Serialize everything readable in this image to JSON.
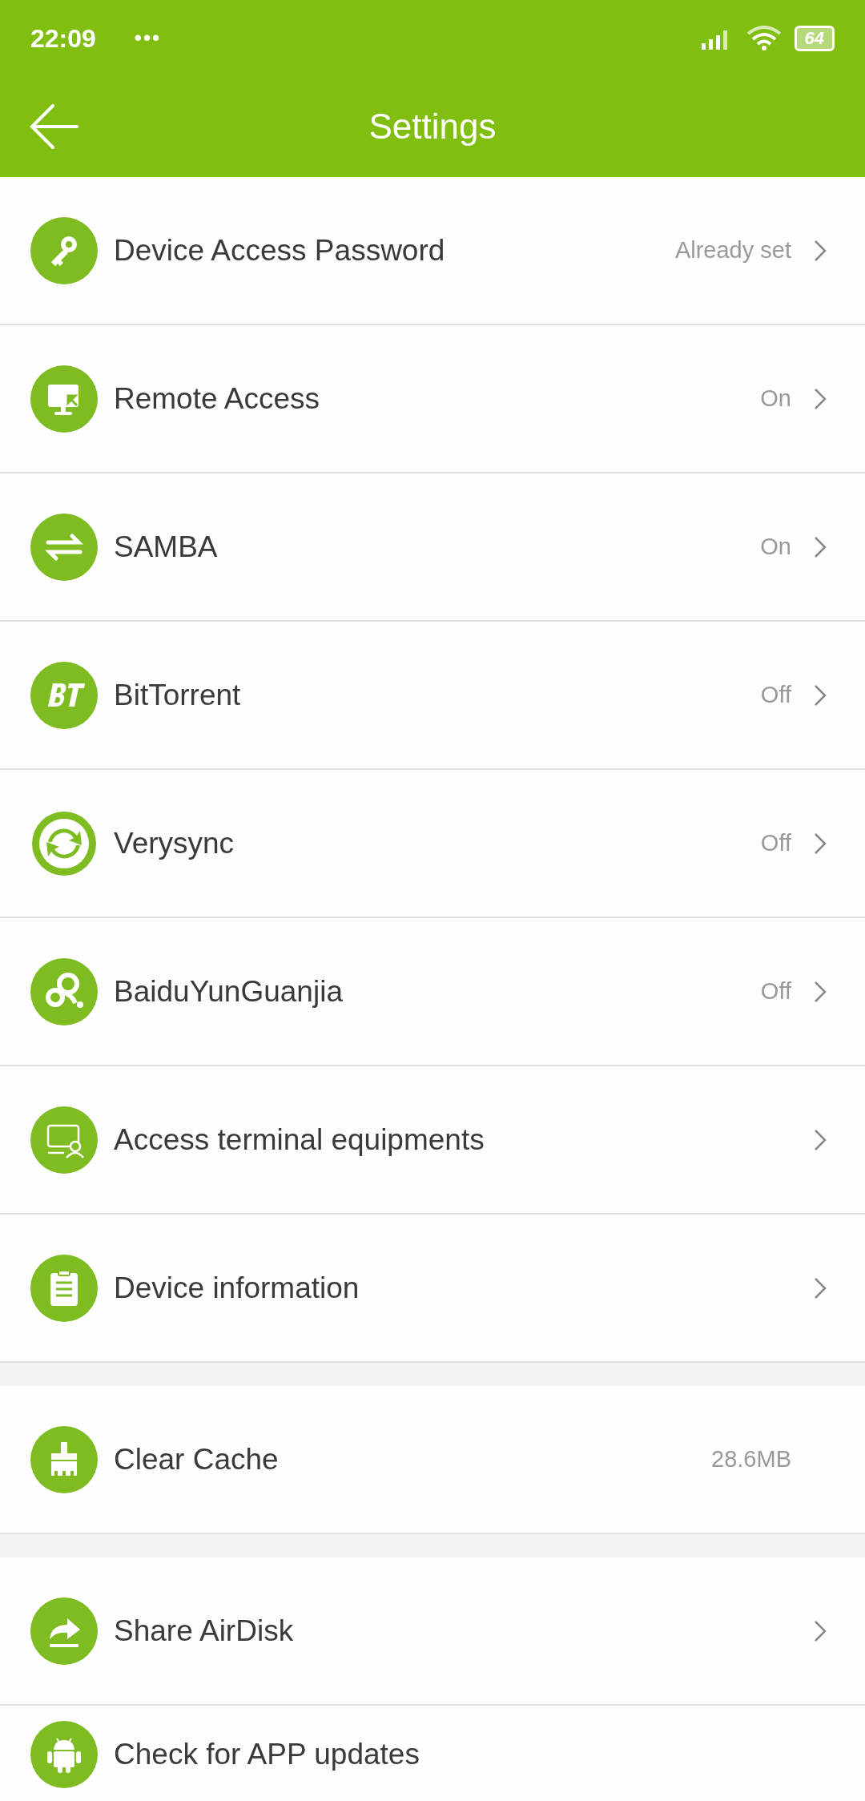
{
  "status_bar": {
    "time": "22:09",
    "dots": "•••",
    "battery": "64"
  },
  "header": {
    "title": "Settings"
  },
  "groups": [
    {
      "items": [
        {
          "label": "Device Access Password",
          "value": "Already set",
          "chevron": true
        },
        {
          "label": "Remote Access",
          "value": "On",
          "chevron": true
        },
        {
          "label": "SAMBA",
          "value": "On",
          "chevron": true
        },
        {
          "label": "BitTorrent",
          "value": "Off",
          "chevron": true
        },
        {
          "label": "Verysync",
          "value": "Off",
          "chevron": true
        },
        {
          "label": "BaiduYunGuanjia",
          "value": "Off",
          "chevron": true
        },
        {
          "label": "Access terminal equipments",
          "chevron": true
        },
        {
          "label": "Device information",
          "chevron": true
        }
      ]
    },
    {
      "items": [
        {
          "label": "Clear Cache",
          "value": "28.6MB",
          "chevron": false
        }
      ]
    },
    {
      "items": [
        {
          "label": "Share AirDisk",
          "chevron": true
        },
        {
          "label": "Check for APP updates",
          "chevron": false
        }
      ]
    }
  ]
}
